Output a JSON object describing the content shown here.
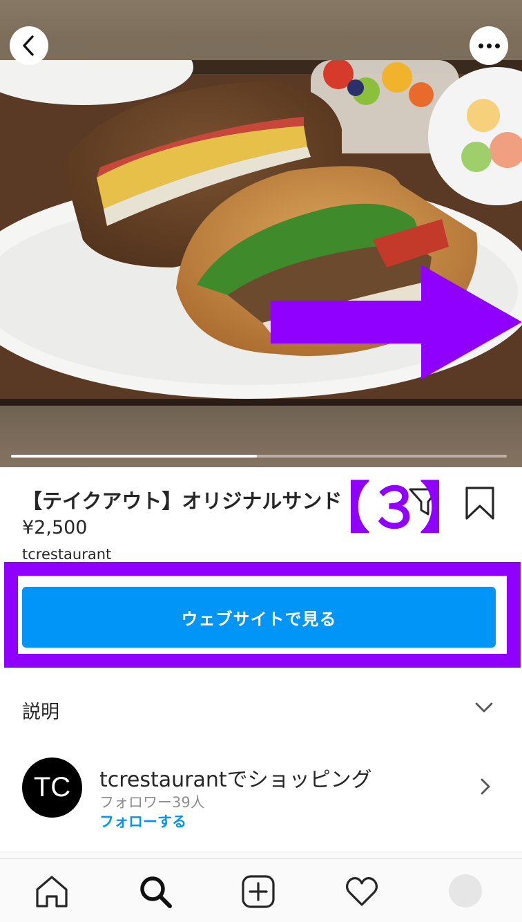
{
  "hero": {
    "image_alt": "sandwich-photo",
    "progress_fraction": 0.496
  },
  "product": {
    "title": "【テイクアウト】オリジナルサンド",
    "price": "¥2,500",
    "merchant": "tcrestaurant"
  },
  "annotation": {
    "step_label": "【３】",
    "accent_color": "#8f00ff"
  },
  "actions": {
    "website_button_label": "ウェブサイトで見る",
    "button_color": "#0095f6"
  },
  "description": {
    "label": "説明"
  },
  "shop": {
    "avatar_text": "TC",
    "title": "tcrestaurantでショッピング",
    "followers": "フォロワー39人",
    "follow_label": "フォローする"
  },
  "nav": {
    "items": [
      "home-icon",
      "search-icon",
      "add-icon",
      "heart-icon",
      "profile-avatar"
    ]
  }
}
